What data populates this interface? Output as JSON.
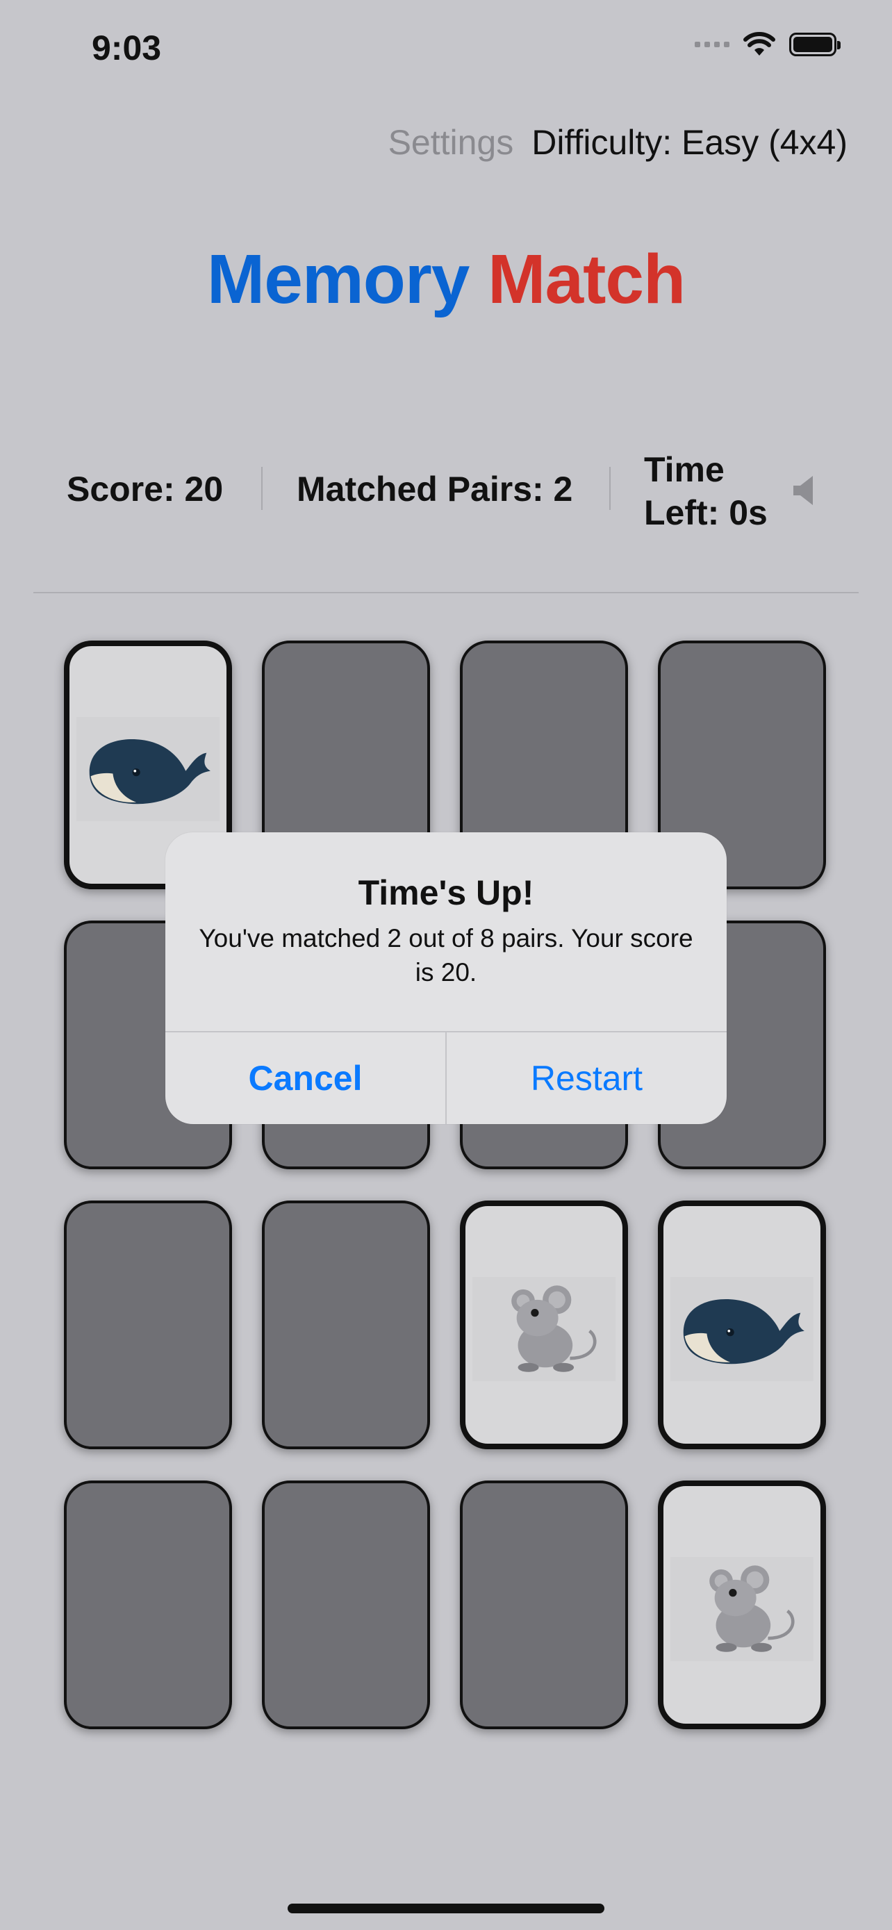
{
  "status_bar": {
    "time": "9:03"
  },
  "top_bar": {
    "settings": "Settings",
    "difficulty": "Difficulty: Easy (4x4)"
  },
  "title": {
    "word1": "Memory",
    "word2": "Match",
    "word1_color": "#0a64d2",
    "word2_color": "#d3332a"
  },
  "stats": {
    "score": "Score: 20",
    "matched_pairs": "Matched Pairs: 2",
    "time_left": "Time Left: 0s"
  },
  "board": {
    "rows": 4,
    "cols": 4,
    "cards": [
      {
        "state": "faceup",
        "image": "whale"
      },
      {
        "state": "facedown"
      },
      {
        "state": "facedown"
      },
      {
        "state": "facedown"
      },
      {
        "state": "facedown"
      },
      {
        "state": "facedown"
      },
      {
        "state": "facedown"
      },
      {
        "state": "facedown"
      },
      {
        "state": "facedown"
      },
      {
        "state": "facedown"
      },
      {
        "state": "faceup",
        "image": "mouse"
      },
      {
        "state": "faceup",
        "image": "whale"
      },
      {
        "state": "facedown"
      },
      {
        "state": "facedown"
      },
      {
        "state": "facedown"
      },
      {
        "state": "faceup",
        "image": "mouse"
      }
    ]
  },
  "alert": {
    "title": "Time's Up!",
    "message": "You've matched 2 out of 8 pairs. Your score is 20.",
    "cancel": "Cancel",
    "restart": "Restart"
  }
}
